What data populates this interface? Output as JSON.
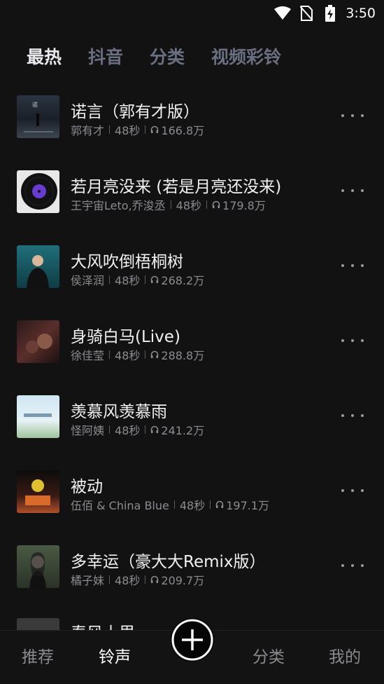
{
  "status": {
    "time": "3:50"
  },
  "tabs": [
    {
      "label": "最热",
      "active": true
    },
    {
      "label": "抖音",
      "active": false
    },
    {
      "label": "分类",
      "active": false
    },
    {
      "label": "视频彩铃",
      "active": false
    }
  ],
  "songs": [
    {
      "title": "诺言（郭有才版）",
      "artist": "郭有才",
      "duration": "48秒",
      "plays": "166.8万",
      "cover": "night-street-cover"
    },
    {
      "title": "若月亮没来 (若是月亮还没来)",
      "artist": "王宇宙Leto,乔浚丞",
      "duration": "48秒",
      "plays": "179.8万",
      "cover": "vinyl-record-cover"
    },
    {
      "title": "大风吹倒梧桐树",
      "artist": "侯泽润",
      "duration": "48秒",
      "plays": "268.2万",
      "cover": "singer-stage-cover"
    },
    {
      "title": "身骑白马(Live)",
      "artist": "徐佳莹",
      "duration": "48秒",
      "plays": "288.8万",
      "cover": "dark-portrait-cover"
    },
    {
      "title": "羡慕风羡慕雨",
      "artist": "怪阿姨",
      "duration": "48秒",
      "plays": "241.2万",
      "cover": "sky-field-cover"
    },
    {
      "title": "被动",
      "artist": "伍佰 & China Blue",
      "duration": "48秒",
      "plays": "197.1万",
      "cover": "band-art-cover"
    },
    {
      "title": "多幸运（豪大大Remix版）",
      "artist": "橘子妹",
      "duration": "48秒",
      "plays": "209.7万",
      "cover": "girl-portrait-cover"
    }
  ],
  "partial_song": {
    "title": "春风十里"
  },
  "bottom_nav": {
    "recommend": "推荐",
    "ringtone": "铃声",
    "category": "分类",
    "mine": "我的"
  }
}
